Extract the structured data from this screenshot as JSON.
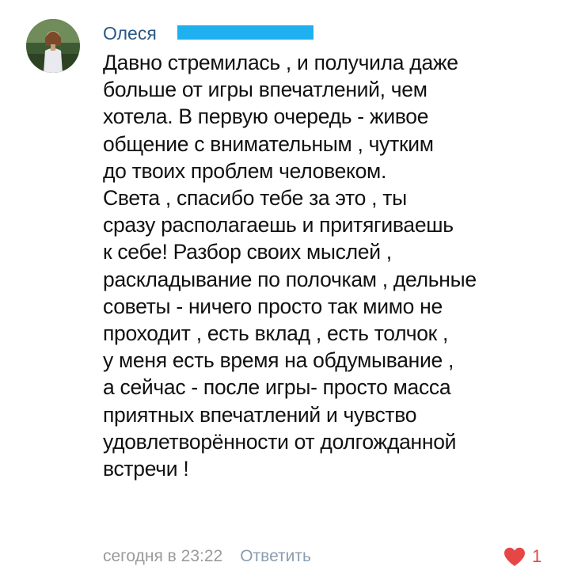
{
  "comment": {
    "author": "Олеся",
    "text_lines": [
      "Давно стремилась , и получила даже",
      "больше от игры впечатлений, чем",
      "хотела. В первую очередь - живое",
      "общение с внимательным , чутким",
      "до твоих проблем человеком.",
      "Света , спасибо тебе за это , ты",
      "сразу располагаешь и притягиваешь",
      "к себе! Разбор своих мыслей ,",
      "раскладывание по полочкам , дельные",
      "советы - ничего просто так мимо не",
      "проходит , есть вклад , есть толчок ,",
      "у меня есть время на обдумывание ,",
      "а сейчас - после игры- просто масса",
      "приятных впечатлений и чувство",
      "удовлетворённости от долгожданной",
      "встречи !"
    ],
    "timestamp": "сегодня в 23:22",
    "reply_label": "Ответить",
    "like_count": "1"
  },
  "colors": {
    "author": "#2a5885",
    "redaction": "#1fb0f0",
    "like": "#e64646",
    "timestamp": "#9a9a9a",
    "reply": "#8a9cb0"
  },
  "icons": {
    "avatar": "user-avatar",
    "like": "heart-icon"
  }
}
